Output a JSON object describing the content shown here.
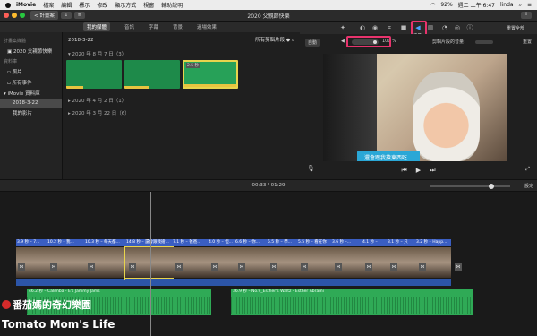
{
  "menubar": {
    "app": "iMovie",
    "items": [
      "檔案",
      "編輯",
      "標示",
      "修改",
      "顯示方式",
      "視窗",
      "輔助說明"
    ],
    "battery": "92%",
    "clock": "週二 上午 6:47",
    "user": "linda"
  },
  "window": {
    "title": "2020 父親節快樂",
    "back_label": "< 計畫案"
  },
  "tabs": [
    "我的媒體",
    "音訊",
    "字幕",
    "背景",
    "過場效果"
  ],
  "adjust": {
    "reset_all": "重置全部",
    "volume_tooltip": "音量",
    "auto_label": "自動",
    "volume_pct": "100 %",
    "dim_label": "剪輯片段的音量：",
    "reset": "重置",
    "colors": {
      "highlight": "#e8336d",
      "active": "#4aa0ff"
    }
  },
  "sidebar": {
    "section1": "計畫案媒體",
    "project": "2020 父親節快樂",
    "section2": "資料庫",
    "items": [
      "照片",
      "所有事件",
      "iMovie 資料庫",
      "2018-3-22",
      "我的影片"
    ]
  },
  "browser": {
    "event": "2018-3-22",
    "filter": "所有剪輯片段",
    "groups": [
      "2020 年 8 月 7 日（3）",
      "2020 年 4 月 2 日（1）",
      "2020 年 3 月 22 日（6）"
    ],
    "clip_tag": "2.5 秒"
  },
  "viewer": {
    "subtitle": "還會跟我搶東西吃..."
  },
  "timeline": {
    "timecode": "00:33 / 01:29",
    "settings": "設定",
    "clips": [
      {
        "title": "3.9 秒 – 7..."
      },
      {
        "title": "10.2 秒 – 我..."
      },
      {
        "title": "10.3 秒 – 每天都..."
      },
      {
        "title": "14.8 秒 – 還會跟我搶..."
      },
      {
        "title": "7.1 秒 – 爸爸..."
      },
      {
        "title": "4.0 秒 – 但..."
      },
      {
        "title": "6.6 秒 – 你..."
      },
      {
        "title": "5.5 秒 – 學..."
      },
      {
        "title": "5.5 秒 – 看在你"
      },
      {
        "title": "3.6 秒 –..."
      },
      {
        "title": "4.1 秒 –"
      },
      {
        "title": "3.1 秒 – 只"
      },
      {
        "title": "3.2 秒 – Happ..."
      }
    ],
    "music": [
      {
        "label": "46.2 秒 – Calimba - E's Jammy Jams"
      },
      {
        "label": "36.9 秒 – No.9_Esther's Waltz - Esther Abrami"
      }
    ]
  },
  "watermark": {
    "line1": "番茄媽的奇幻樂園",
    "line2": "Tomato Mom's Life"
  }
}
